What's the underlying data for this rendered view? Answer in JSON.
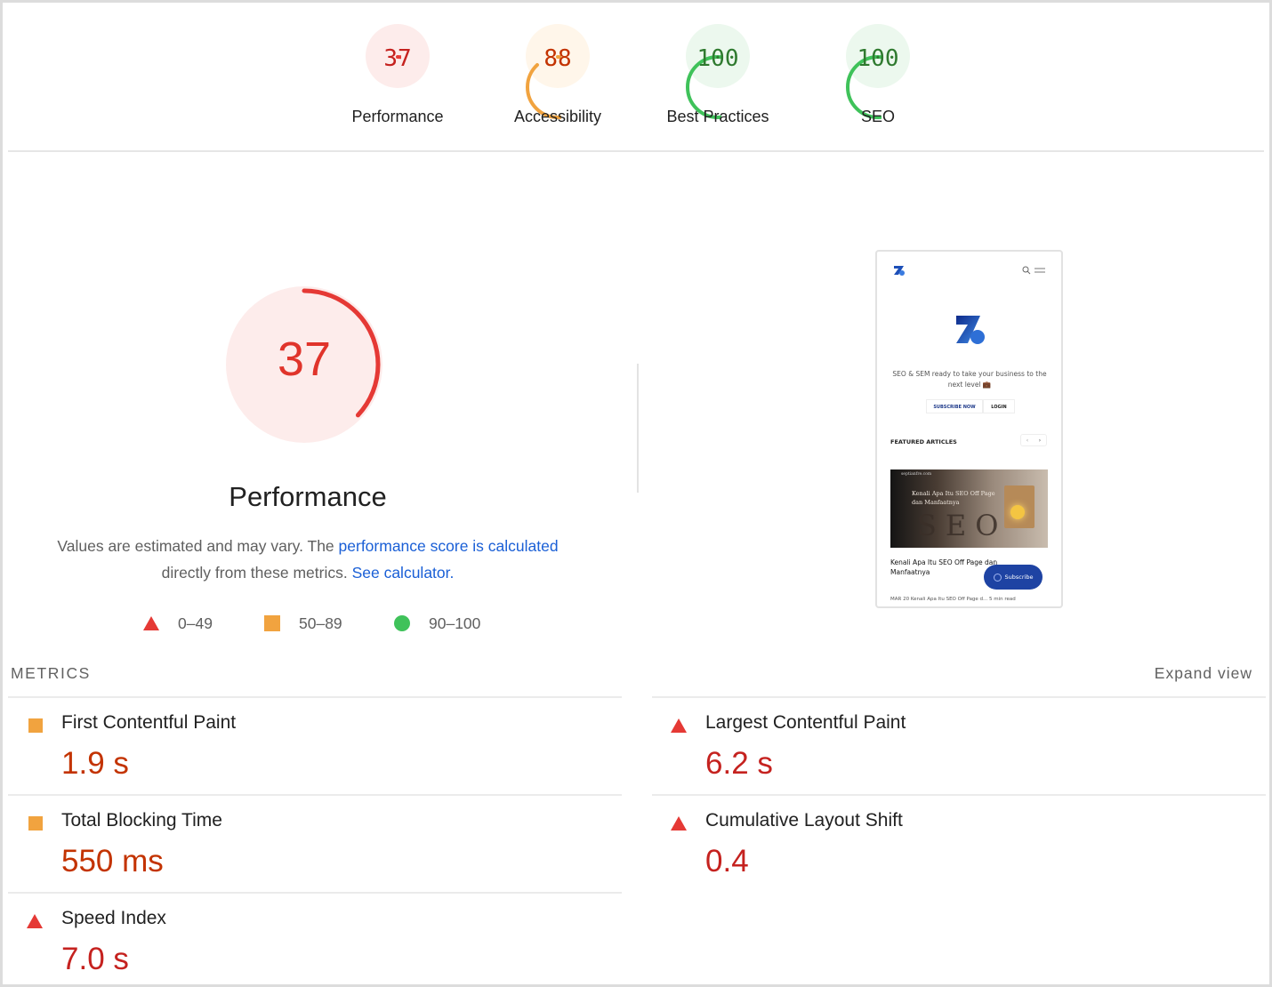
{
  "categories": [
    {
      "label": "Performance",
      "score": 37,
      "status": "fail"
    },
    {
      "label": "Accessibility",
      "score": 88,
      "status": "average"
    },
    {
      "label": "Best Practices",
      "score": 100,
      "status": "pass"
    },
    {
      "label": "SEO",
      "score": 100,
      "status": "pass"
    }
  ],
  "colors": {
    "fail": "#e53935",
    "fail_bg": "#fdeceb",
    "fail_text": "#c5221f",
    "average": "#f1a33f",
    "average_bg": "#fff6ea",
    "average_text": "#c33300",
    "pass": "#3fc25a",
    "pass_bg": "#ecf8ee",
    "pass_text": "#2f7a2f",
    "link": "#1a5fd6"
  },
  "performance": {
    "score": 37,
    "title": "Performance",
    "desc_prefix": "Values are estimated and may vary. The ",
    "desc_link": "performance score is calculated",
    "desc_middle": " directly from these metrics. ",
    "desc_link2": "See calculator."
  },
  "legend": [
    {
      "icon": "triangle-icon",
      "range": "0–49"
    },
    {
      "icon": "square-icon",
      "range": "50–89"
    },
    {
      "icon": "circle-icon",
      "range": "90–100"
    }
  ],
  "thumbnail": {
    "tagline": "SEO & SEM ready to take your business to the next level 💼",
    "subscribe_now": "SUBSCRIBE NOW",
    "login": "LOGIN",
    "featured": "FEATURED ARTICLES",
    "image_caption": "Kenali Apa Itu SEO Off Page dan Manfaatnya",
    "image_source": "septianfre.com",
    "image_word": "SEO",
    "article_title": "Kenali Apa Itu SEO Off Page dan Manfaatnya",
    "subscribe": "Subscribe",
    "footer": "MAR 20   Kenali Apa Itu SEO Off Page d...   5 min read"
  },
  "metrics": {
    "heading": "METRICS",
    "expand": "Expand view",
    "items": [
      {
        "name": "First Contentful Paint",
        "value": "1.9 s",
        "status": "average"
      },
      {
        "name": "Largest Contentful Paint",
        "value": "6.2 s",
        "status": "fail"
      },
      {
        "name": "Total Blocking Time",
        "value": "550 ms",
        "status": "average"
      },
      {
        "name": "Cumulative Layout Shift",
        "value": "0.4",
        "status": "fail"
      },
      {
        "name": "Speed Index",
        "value": "7.0 s",
        "status": "fail"
      }
    ]
  }
}
